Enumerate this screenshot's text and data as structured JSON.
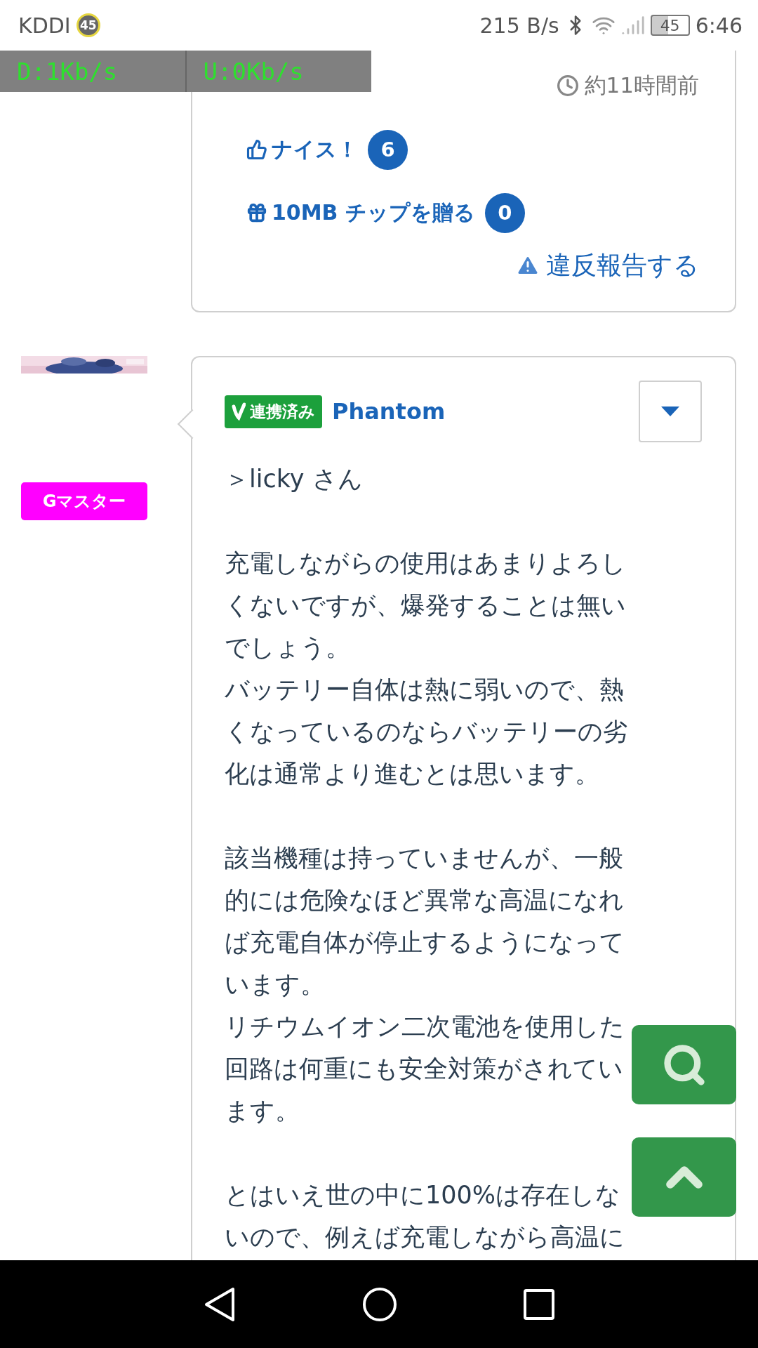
{
  "status_bar": {
    "carrier": "KDDI",
    "carrier_badge": "45",
    "net_speed": "215 B/s",
    "battery": "45",
    "time": "6:46"
  },
  "speed_overlay": {
    "download": "D:1Kb/s",
    "upload": "U:0Kb/s"
  },
  "previous_post": {
    "time": "約11時間前",
    "nice": {
      "label": "ナイス！",
      "count": "6"
    },
    "tip": {
      "label": "10MB チップを贈る",
      "count": "0"
    },
    "report": "違反報告する"
  },
  "post": {
    "rank_badge": "Gマスター",
    "linked_badge": "連携済み",
    "author": "Phantom",
    "body": [
      [
        "＞licky さん"
      ],
      [
        "充電しながらの使用はあまりよろし",
        "くないですが、爆発することは無い",
        "でしょう。",
        "バッテリー自体は熱に弱いので、熱",
        "くなっているのならバッテリーの劣",
        "化は通常より進むとは思います。"
      ],
      [
        "該当機種は持っていませんが、一般",
        "的には危険なほど異常な高温になれ",
        "ば充電自体が停止するようになって",
        "います。",
        "リチウムイオン二次電池を使用した",
        "回路は何重にも安全対策がされてい",
        "ます。"
      ],
      [
        "とはいえ世の中に100%は存在しな",
        "いので、例えば充電しながら高温に"
      ]
    ]
  }
}
